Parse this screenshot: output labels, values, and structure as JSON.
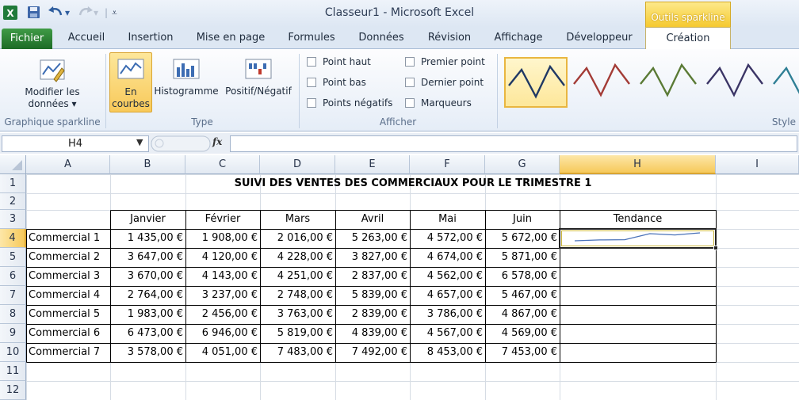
{
  "window": {
    "title": "Classeur1  -  Microsoft Excel",
    "context_tab": "Outils sparkline"
  },
  "tabs": [
    "Fichier",
    "Accueil",
    "Insertion",
    "Mise en page",
    "Formules",
    "Données",
    "Révision",
    "Affichage",
    "Développeur",
    "Création"
  ],
  "ribbon": {
    "modifier_line1": "Modifier les",
    "modifier_line2": "données ▾",
    "group_sparkline": "Graphique sparkline",
    "type_line": "En",
    "type_line2": "courbes",
    "type_histogram": "Histogramme",
    "type_winloss": "Positif/Négatif",
    "group_type": "Type",
    "checks": [
      "Point haut",
      "Point bas",
      "Points négatifs",
      "Premier point",
      "Dernier point",
      "Marqueurs"
    ],
    "group_show": "Afficher",
    "group_style": "Style",
    "style_colors": [
      "#1f3864",
      "#a33b36",
      "#5a7a35",
      "#3b3566",
      "#2f7f95"
    ]
  },
  "formula_bar": {
    "name_box": "H4",
    "fx": "fx",
    "formula": ""
  },
  "sheet": {
    "columns": [
      "A",
      "B",
      "C",
      "D",
      "E",
      "F",
      "G",
      "H",
      "I"
    ],
    "rows": [
      "1",
      "2",
      "3",
      "4",
      "5",
      "6",
      "7",
      "8",
      "9",
      "10",
      "11",
      "12"
    ],
    "selected_column": "H",
    "selected_row": "4",
    "title": "SUIVI DES VENTES DES COMMERCIAUX POUR LE TRIMESTRE 1",
    "headers": [
      "Janvier",
      "Février",
      "Mars",
      "Avril",
      "Mai",
      "Juin",
      "Tendance"
    ],
    "data": [
      {
        "name": "Commercial 1",
        "values": [
          "1 435,00 €",
          "1 908,00 €",
          "2 016,00 €",
          "5 263,00 €",
          "4 572,00 €",
          "5 672,00 €"
        ]
      },
      {
        "name": "Commercial 2",
        "values": [
          "3 647,00 €",
          "4 120,00 €",
          "4 228,00 €",
          "3 827,00 €",
          "4 674,00 €",
          "5 871,00 €"
        ]
      },
      {
        "name": "Commercial 3",
        "values": [
          "3 670,00 €",
          "4 143,00 €",
          "4 251,00 €",
          "2 837,00 €",
          "4 562,00 €",
          "6 578,00 €"
        ]
      },
      {
        "name": "Commercial 4",
        "values": [
          "2 764,00 €",
          "3 237,00 €",
          "2 748,00 €",
          "5 839,00 €",
          "4 657,00 €",
          "5 467,00 €"
        ]
      },
      {
        "name": "Commercial 5",
        "values": [
          "1 983,00 €",
          "2 456,00 €",
          "3 763,00 €",
          "2 839,00 €",
          "3 786,00 €",
          "4 867,00 €"
        ]
      },
      {
        "name": "Commercial 6",
        "values": [
          "6 473,00 €",
          "6 946,00 €",
          "5 819,00 €",
          "4 839,00 €",
          "4 567,00 €",
          "4 569,00 €"
        ]
      },
      {
        "name": "Commercial 7",
        "values": [
          "3 578,00 €",
          "4 051,00 €",
          "7 483,00 €",
          "7 492,00 €",
          "8 453,00 €",
          "7 453,00 €"
        ]
      }
    ],
    "sparkline_values": [
      1435,
      1908,
      2016,
      5263,
      4572,
      5672
    ],
    "sparkline_color": "#4a72b8"
  }
}
